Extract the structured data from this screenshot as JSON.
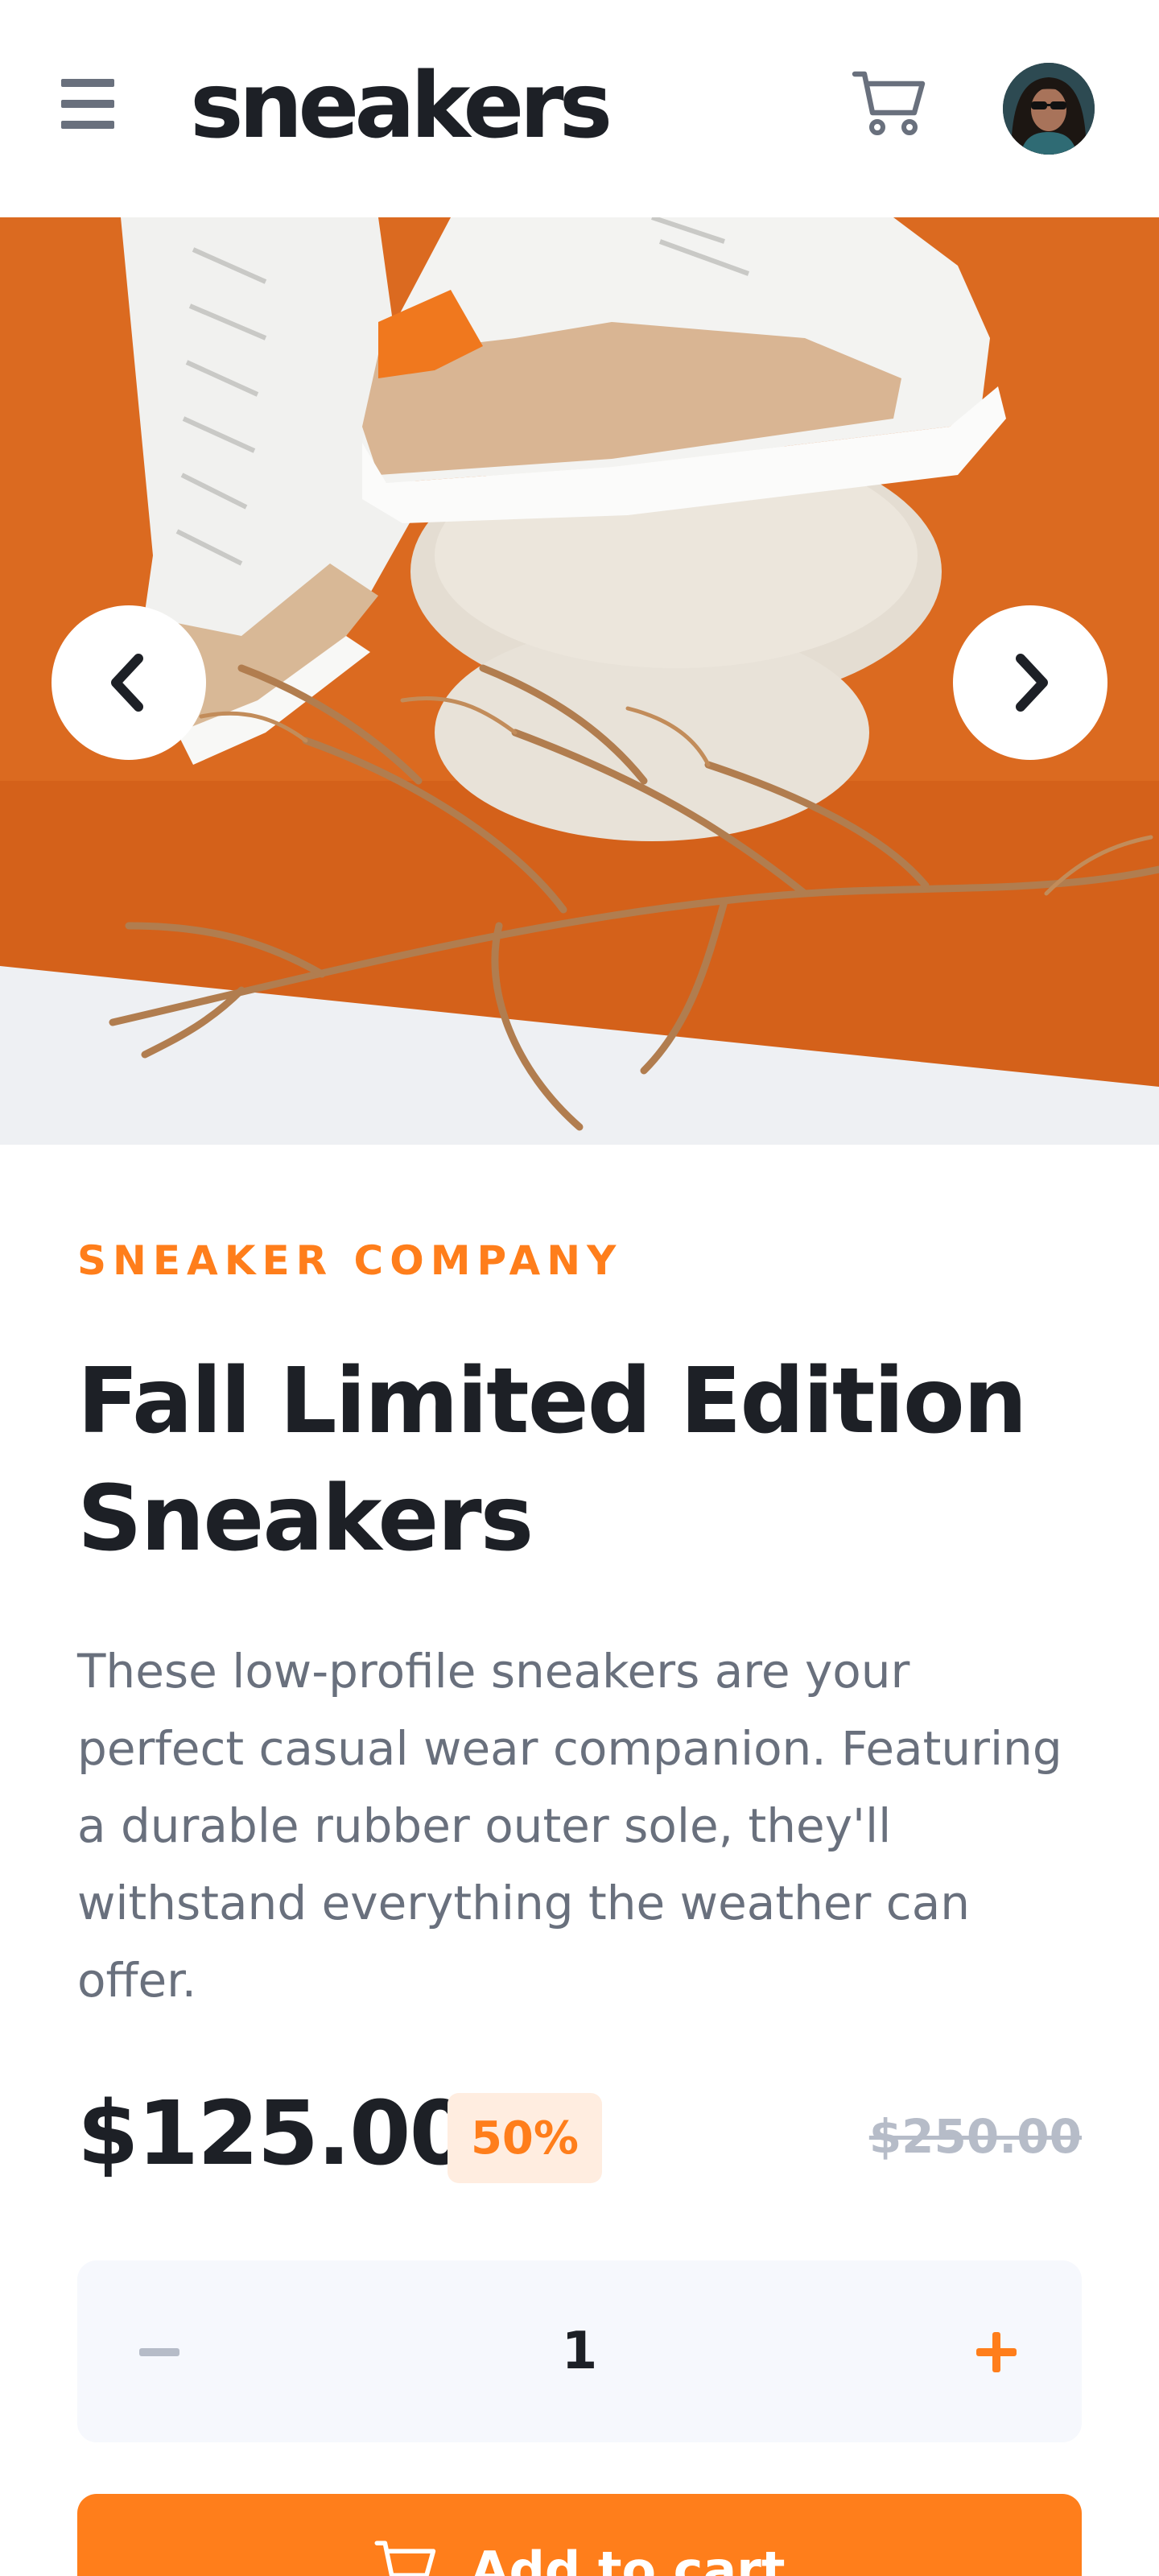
{
  "header": {
    "logo": "sneakers"
  },
  "icons": {
    "menu": "menu-icon",
    "cart": "cart-icon",
    "prev": "chevron-left-icon",
    "next": "chevron-right-icon"
  },
  "product": {
    "company": "SNEAKER COMPANY",
    "title": "Fall Limited Edition Sneakers",
    "description": "These low-profile sneakers are your perfect casual wear companion. Featuring a durable rubber outer sole, they'll withstand everything the weather can offer.",
    "price": "$125.00",
    "discount": "50%",
    "original_price": "$250.00",
    "quantity": "1",
    "add_to_cart_label": "Add to cart"
  },
  "colors": {
    "accent": "#ff7e1b",
    "accent_pale": "#ffede0",
    "dark": "#1d2026",
    "grey": "#69707d",
    "light_grey": "#b6bcc8",
    "panel": "#f6f8fd"
  }
}
